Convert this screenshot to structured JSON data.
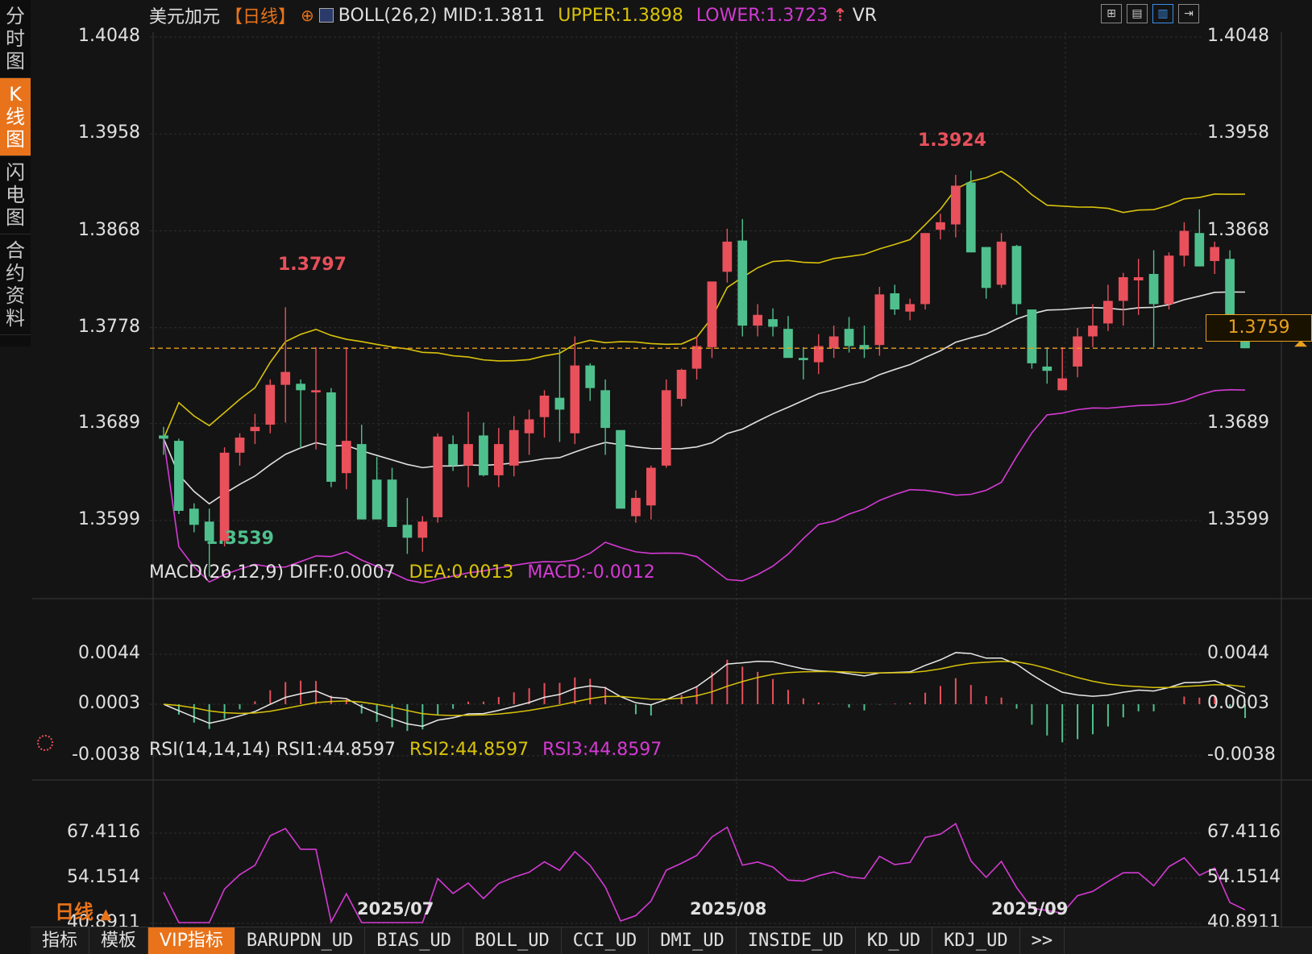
{
  "sidebar": {
    "tabs": [
      {
        "label": "分时图",
        "chars": [
          "分",
          "时",
          "图"
        ],
        "active": false
      },
      {
        "label": "K线图",
        "chars": [
          "K",
          "线",
          "图"
        ],
        "active": true
      },
      {
        "label": "闪电图",
        "chars": [
          "闪",
          "电",
          "图"
        ],
        "active": false
      },
      {
        "label": "合约资料",
        "chars": [
          "合",
          "约",
          "资",
          "料"
        ],
        "active": false
      }
    ]
  },
  "header": {
    "pair": "美元加元",
    "period": "【日线】",
    "boll": "BOLL(26,2) MID:1.3811",
    "upper": "UPPER:1.3898",
    "lower": "LOWER:1.3723",
    "vr": "VR"
  },
  "toolbar_icons": [
    "grid-icon",
    "chart-icon",
    "candle-icon",
    "arrow-in-icon"
  ],
  "main_axis": {
    "ticks": [
      "1.4048",
      "1.3958",
      "1.3868",
      "1.3778",
      "1.3689",
      "1.3599"
    ],
    "values": [
      1.4048,
      1.3958,
      1.3868,
      1.3778,
      1.3689,
      1.3599
    ]
  },
  "current_price": "1.3759",
  "high_label": "1.3924",
  "mid_high_label": "1.3797",
  "low_label": "1.3539",
  "macd": {
    "title": "MACD(26,12,9)",
    "diff": "DIFF:0.0007",
    "dea": "DEA:0.0013",
    "macd": "MACD:-0.0012",
    "ticks": [
      "0.0044",
      "0.0003",
      "-0.0038"
    ]
  },
  "rsi": {
    "title": "RSI(14,14,14)",
    "rsi1": "RSI1:44.8597",
    "rsi2": "RSI2:44.8597",
    "rsi3": "RSI3:44.8597",
    "ticks": [
      "67.4116",
      "54.1514",
      "40.8911"
    ]
  },
  "dates": [
    "2025/07",
    "2025/08",
    "2025/09"
  ],
  "period_bottom": "日线",
  "period_arrow": "▲",
  "bottom_tabs": [
    {
      "label": "指标",
      "cn": true
    },
    {
      "label": "模板",
      "cn": true
    },
    {
      "label": "VIP指标",
      "vip": true
    },
    {
      "label": "BARUPDN_UD"
    },
    {
      "label": "BIAS_UD"
    },
    {
      "label": "BOLL_UD"
    },
    {
      "label": "CCI_UD"
    },
    {
      "label": "DMI_UD"
    },
    {
      "label": "INSIDE_UD"
    },
    {
      "label": "KD_UD"
    },
    {
      "label": "KDJ_UD"
    },
    {
      "label": ">>"
    }
  ],
  "colors": {
    "up": "#e8505b",
    "down": "#4fc08d",
    "upper": "#d8c20a",
    "lower": "#d43ad4",
    "mid": "#e0e0e0",
    "accent": "#e8731a"
  },
  "chart_data": {
    "type": "candlestick",
    "candles": [
      [
        1.3678,
        1.3686,
        1.366,
        1.3675
      ],
      [
        1.3673,
        1.3675,
        1.3605,
        1.3608
      ],
      [
        1.361,
        1.3615,
        1.3588,
        1.3595
      ],
      [
        1.3598,
        1.361,
        1.3547,
        1.358
      ],
      [
        1.358,
        1.3667,
        1.3575,
        1.3662
      ],
      [
        1.3662,
        1.368,
        1.365,
        1.3676
      ],
      [
        1.3682,
        1.3698,
        1.367,
        1.3686
      ],
      [
        1.3688,
        1.373,
        1.368,
        1.3725
      ],
      [
        1.3725,
        1.3797,
        1.369,
        1.3737
      ],
      [
        1.3726,
        1.373,
        1.3666,
        1.372
      ],
      [
        1.3718,
        1.376,
        1.3665,
        1.372
      ],
      [
        1.3718,
        1.3722,
        1.363,
        1.3635
      ],
      [
        1.3643,
        1.376,
        1.3628,
        1.3673
      ],
      [
        1.367,
        1.3688,
        1.36,
        1.36
      ],
      [
        1.3637,
        1.3658,
        1.361,
        1.36
      ],
      [
        1.3637,
        1.3648,
        1.3596,
        1.3593
      ],
      [
        1.3595,
        1.362,
        1.3568,
        1.3583
      ],
      [
        1.3583,
        1.3603,
        1.357,
        1.3598
      ],
      [
        1.3602,
        1.368,
        1.3597,
        1.3677
      ],
      [
        1.367,
        1.3678,
        1.3645,
        1.365
      ],
      [
        1.365,
        1.37,
        1.363,
        1.367
      ],
      [
        1.3678,
        1.369,
        1.364,
        1.3641
      ],
      [
        1.3641,
        1.3685,
        1.363,
        1.367
      ],
      [
        1.365,
        1.3696,
        1.364,
        1.3683
      ],
      [
        1.368,
        1.3702,
        1.366,
        1.3693
      ],
      [
        1.3695,
        1.372,
        1.3676,
        1.3715
      ],
      [
        1.3713,
        1.3758,
        1.3672,
        1.3702
      ],
      [
        1.368,
        1.377,
        1.367,
        1.3743
      ],
      [
        1.3743,
        1.3745,
        1.371,
        1.3722
      ],
      [
        1.372,
        1.373,
        1.366,
        1.3685
      ],
      [
        1.3683,
        1.368,
        1.362,
        1.361
      ],
      [
        1.3603,
        1.3627,
        1.3597,
        1.362
      ],
      [
        1.3613,
        1.365,
        1.36,
        1.3648
      ],
      [
        1.365,
        1.373,
        1.3648,
        1.372
      ],
      [
        1.3712,
        1.374,
        1.3705,
        1.3739
      ],
      [
        1.374,
        1.377,
        1.373,
        1.3761
      ],
      [
        1.376,
        1.382,
        1.375,
        1.3821
      ],
      [
        1.383,
        1.387,
        1.382,
        1.3858
      ],
      [
        1.3859,
        1.3879,
        1.377,
        1.378
      ],
      [
        1.378,
        1.38,
        1.377,
        1.379
      ],
      [
        1.3786,
        1.3796,
        1.377,
        1.3779
      ],
      [
        1.3777,
        1.3789,
        1.3752,
        1.375
      ],
      [
        1.375,
        1.376,
        1.373,
        1.3748
      ],
      [
        1.3746,
        1.3772,
        1.3735,
        1.3761
      ],
      [
        1.3759,
        1.378,
        1.375,
        1.377
      ],
      [
        1.3777,
        1.3788,
        1.3755,
        1.3761
      ],
      [
        1.3762,
        1.378,
        1.375,
        1.3758
      ],
      [
        1.3762,
        1.3816,
        1.3752,
        1.3809
      ],
      [
        1.381,
        1.3818,
        1.379,
        1.3795
      ],
      [
        1.3793,
        1.3805,
        1.3785,
        1.38
      ],
      [
        1.38,
        1.3866,
        1.3795,
        1.3866
      ],
      [
        1.3869,
        1.3884,
        1.386,
        1.3876
      ],
      [
        1.3874,
        1.392,
        1.3862,
        1.391
      ],
      [
        1.3913,
        1.3924,
        1.386,
        1.3848
      ],
      [
        1.3853,
        1.3852,
        1.3805,
        1.3815
      ],
      [
        1.3818,
        1.3866,
        1.3815,
        1.3858
      ],
      [
        1.3854,
        1.3855,
        1.379,
        1.38
      ],
      [
        1.3795,
        1.379,
        1.374,
        1.3745
      ],
      [
        1.3742,
        1.376,
        1.3726,
        1.3738
      ],
      [
        1.372,
        1.376,
        1.372,
        1.3731
      ],
      [
        1.3742,
        1.3778,
        1.3732,
        1.377
      ],
      [
        1.377,
        1.38,
        1.376,
        1.378
      ],
      [
        1.3782,
        1.3818,
        1.3775,
        1.3803
      ],
      [
        1.3803,
        1.3829,
        1.378,
        1.3825
      ],
      [
        1.3822,
        1.3842,
        1.379,
        1.3825
      ],
      [
        1.3828,
        1.385,
        1.376,
        1.38
      ],
      [
        1.38,
        1.3848,
        1.3795,
        1.3845
      ],
      [
        1.3845,
        1.3876,
        1.3835,
        1.3868
      ],
      [
        1.3866,
        1.3888,
        1.3835,
        1.3835
      ],
      [
        1.384,
        1.3858,
        1.3828,
        1.3853
      ],
      [
        1.3842,
        1.385,
        1.3778,
        1.3778
      ],
      [
        1.3775,
        1.378,
        1.3759,
        1.3759
      ]
    ]
  }
}
